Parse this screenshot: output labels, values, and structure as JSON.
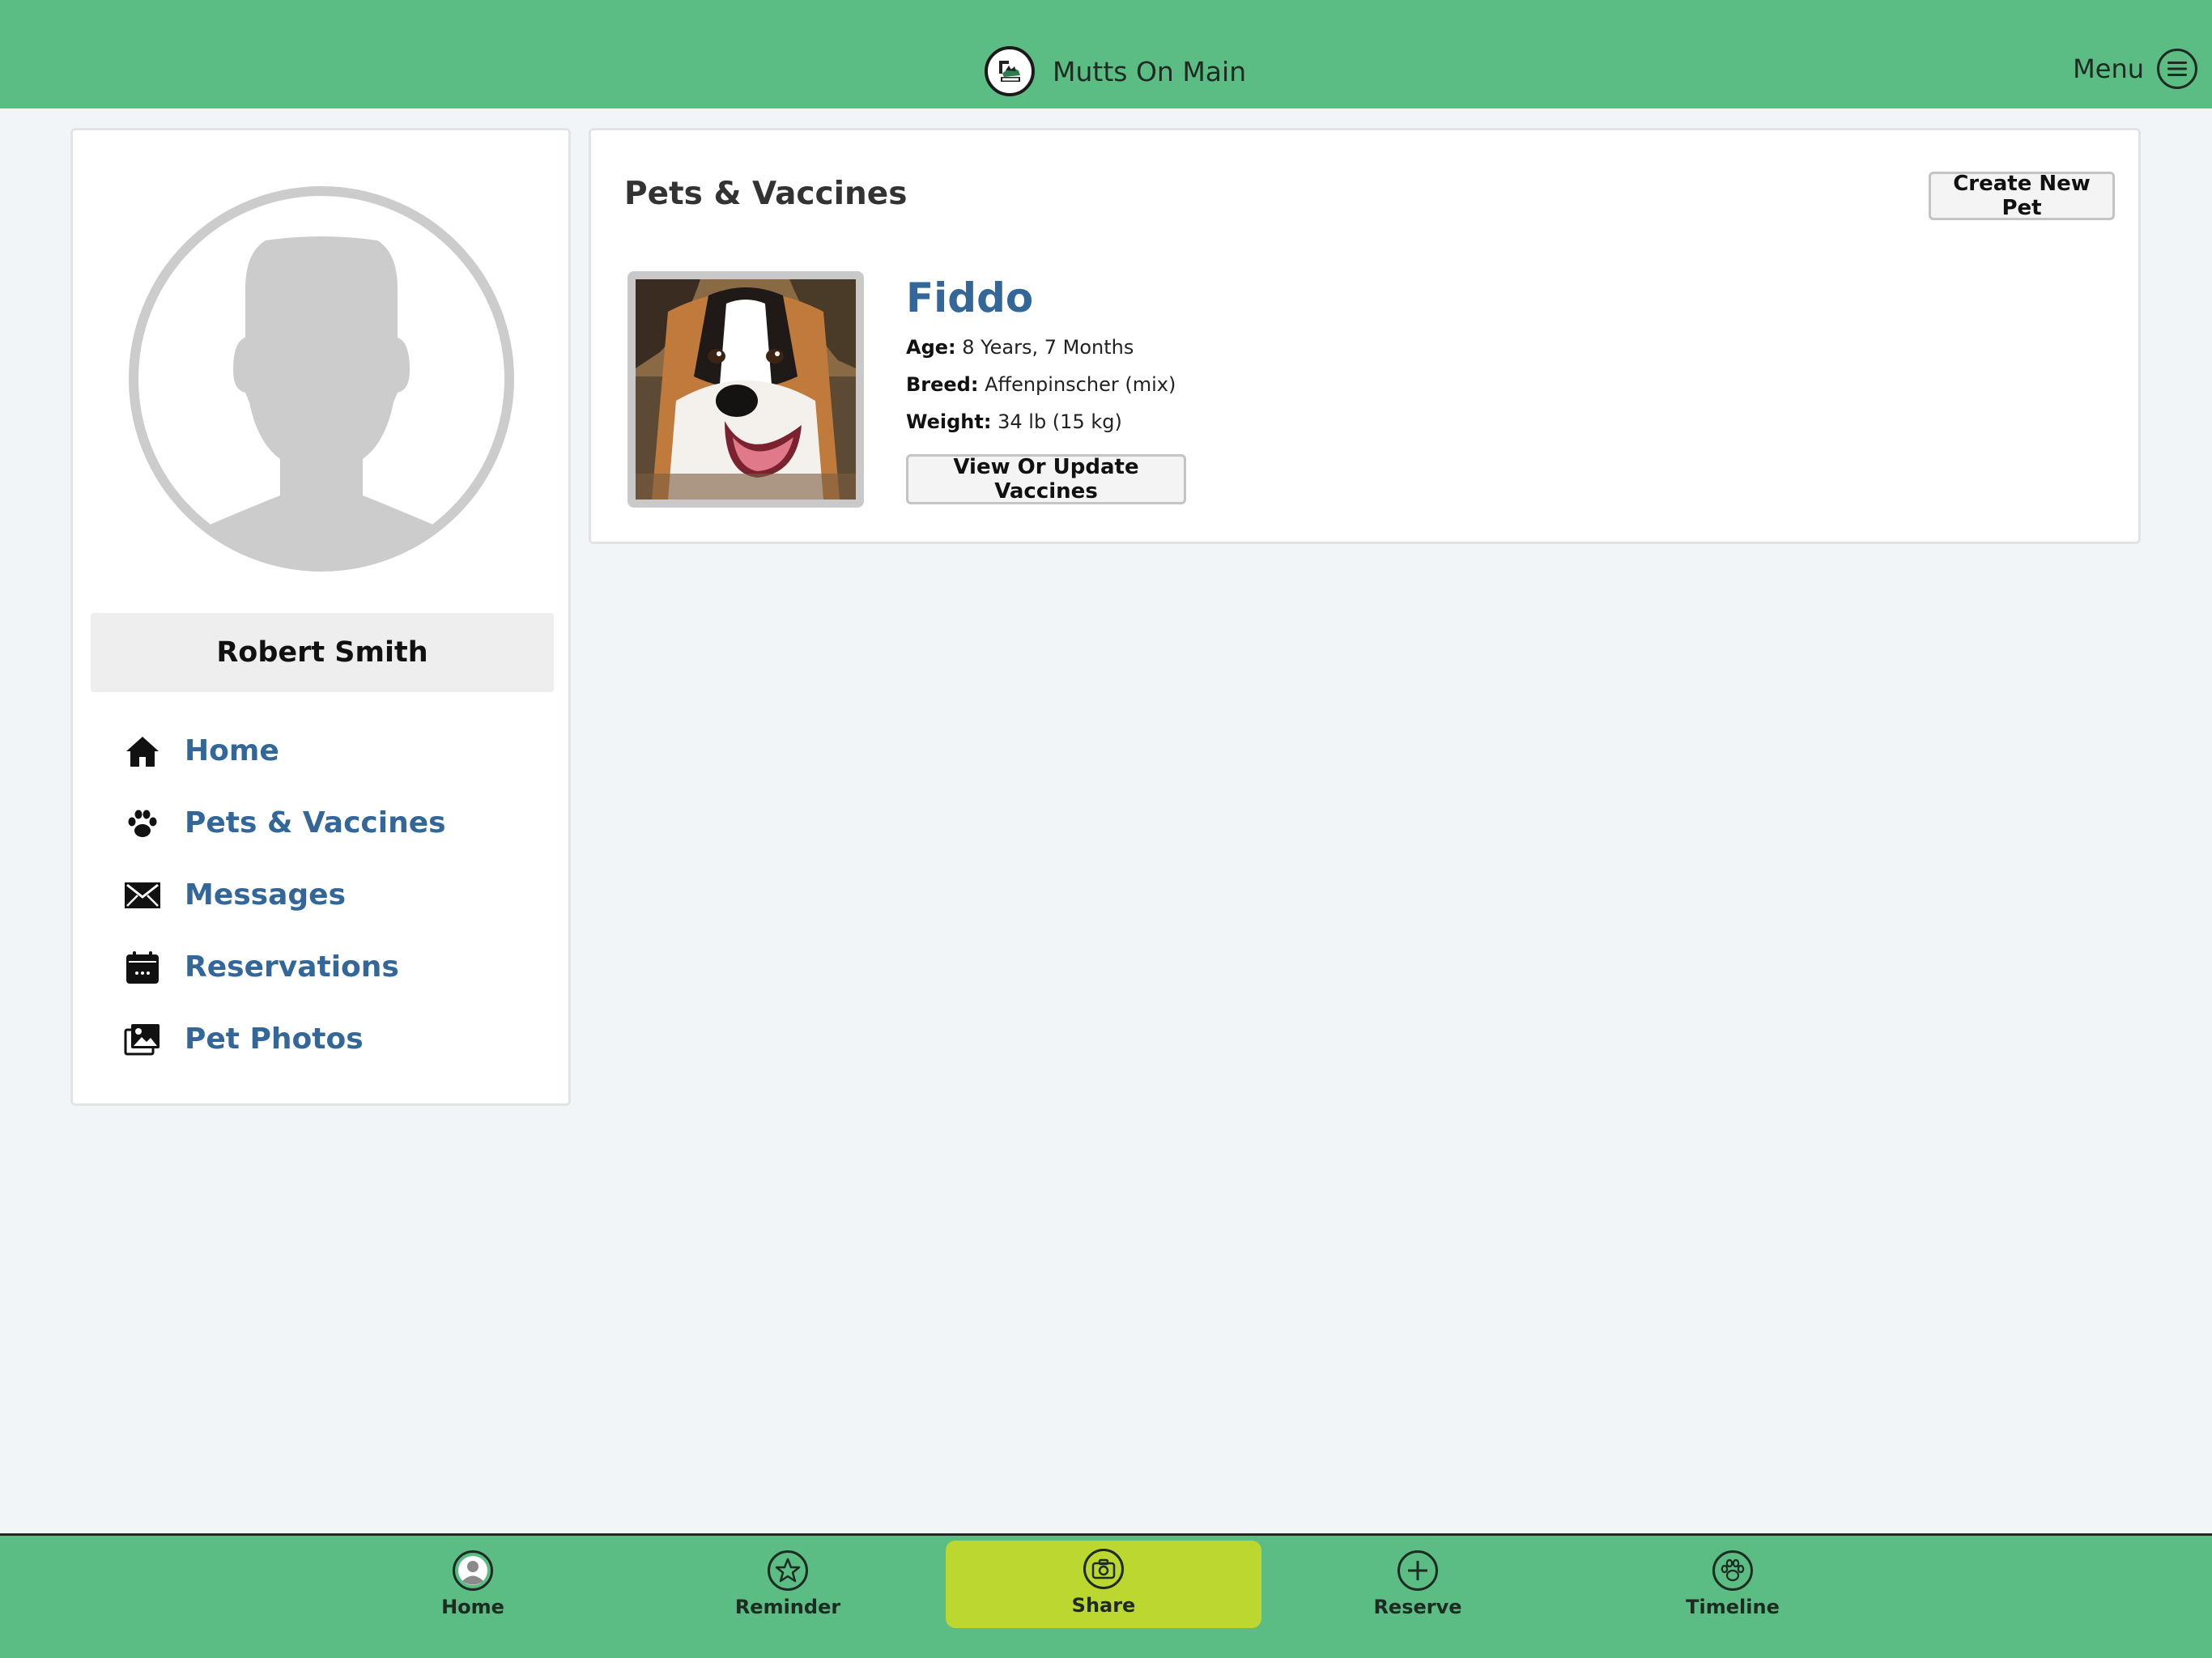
{
  "header": {
    "app_name": "Mutts On Main",
    "logo_icon": "mutts-logo-icon",
    "menu_label": "Menu",
    "menu_icon": "hamburger-circle-icon"
  },
  "sidebar": {
    "user_name": "Robert Smith",
    "avatar_icon": "user-silhouette-icon",
    "items": [
      {
        "label": "Home",
        "icon": "home-icon"
      },
      {
        "label": "Pets & Vaccines",
        "icon": "paw-icon"
      },
      {
        "label": "Messages",
        "icon": "envelope-icon"
      },
      {
        "label": "Reservations",
        "icon": "calendar-icon"
      },
      {
        "label": "Pet Photos",
        "icon": "photos-icon"
      }
    ]
  },
  "main": {
    "title": "Pets & Vaccines",
    "create_button": "Create New Pet",
    "pets": [
      {
        "name": "Fiddo",
        "age_label": "Age:",
        "age": "8 Years, 7 Months",
        "breed_label": "Breed:",
        "breed": "Affenpinscher (mix)",
        "weight_label": "Weight:",
        "weight": "34 lb (15 kg)",
        "vaccines_button": "View Or Update Vaccines"
      }
    ]
  },
  "tabbar": {
    "active": "Share",
    "items": [
      {
        "label": "Home",
        "icon": "user-circle-icon"
      },
      {
        "label": "Reminder",
        "icon": "star-icon"
      },
      {
        "label": "Share",
        "icon": "camera-icon"
      },
      {
        "label": "Reserve",
        "icon": "plus-icon"
      },
      {
        "label": "Timeline",
        "icon": "paw-icon"
      }
    ]
  },
  "colors": {
    "header_green": "#5cbd84",
    "active_tab": "#bcd72f",
    "link_blue": "#336699",
    "page_bg": "#f1f5f8"
  }
}
